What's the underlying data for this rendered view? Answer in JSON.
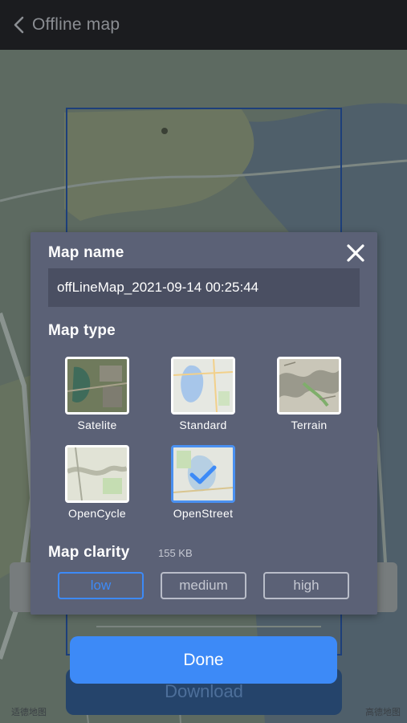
{
  "header": {
    "title": "Offline map",
    "back_icon": "chevron-left-icon"
  },
  "map": {
    "download_label": "Download",
    "attribution": "高德地图",
    "attribution_left": "适德地图"
  },
  "modal": {
    "map_name_label": "Map name",
    "map_name_value": "offLineMap_2021-09-14 00:25:44",
    "map_type_label": "Map type",
    "map_types": [
      {
        "label": "Satelite",
        "selected": false,
        "icon": "satellite-thumbnail"
      },
      {
        "label": "Standard",
        "selected": false,
        "icon": "standard-thumbnail"
      },
      {
        "label": "Terrain",
        "selected": false,
        "icon": "terrain-thumbnail"
      },
      {
        "label": "OpenCycle",
        "selected": false,
        "icon": "opencycle-thumbnail"
      },
      {
        "label": "OpenStreet",
        "selected": true,
        "icon": "openstreet-thumbnail"
      }
    ],
    "map_clarity_label": "Map clarity",
    "map_clarity_size": "155 KB",
    "clarity_options": [
      {
        "label": "low",
        "active": true
      },
      {
        "label": "medium",
        "active": false
      },
      {
        "label": "high",
        "active": false
      }
    ],
    "close_icon": "close-icon"
  },
  "done_label": "Done",
  "colors": {
    "header_bg": "#1b1c1f",
    "modal_bg": "#5b6176",
    "input_bg": "#4a4f62",
    "accent": "#3d8af7",
    "download_bg": "#25446b"
  }
}
